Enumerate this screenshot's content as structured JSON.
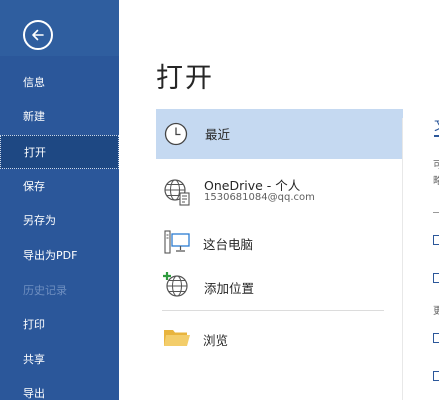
{
  "sidebar": {
    "back_label": "",
    "items": [
      {
        "label": "信息"
      },
      {
        "label": "新建"
      },
      {
        "label": "打开"
      },
      {
        "label": "保存"
      },
      {
        "label": "另存为"
      },
      {
        "label": "导出为PDF"
      },
      {
        "label": "历史记录"
      },
      {
        "label": "打印"
      },
      {
        "label": "共享"
      },
      {
        "label": "导出"
      }
    ]
  },
  "main": {
    "title": "打开",
    "locations": [
      {
        "label": "最近",
        "icon": "clock-icon"
      },
      {
        "label": "OneDrive - 个人",
        "sub": "1530681084@qq.com",
        "icon": "onedrive-globe-icon"
      },
      {
        "label": "这台电脑",
        "icon": "computer-icon"
      },
      {
        "label": "添加位置",
        "icon": "add-location-globe-icon"
      },
      {
        "label": "浏览",
        "icon": "folder-icon"
      }
    ]
  },
  "right_panel": {
    "title_fragment": "文",
    "line1": "可",
    "line2": "略",
    "group_label": "更"
  },
  "colors": {
    "sidebar": "#2b579a",
    "sidebar_active": "#1e4883",
    "selected_location": "#c5d9f1",
    "accent": "#2b579a"
  }
}
